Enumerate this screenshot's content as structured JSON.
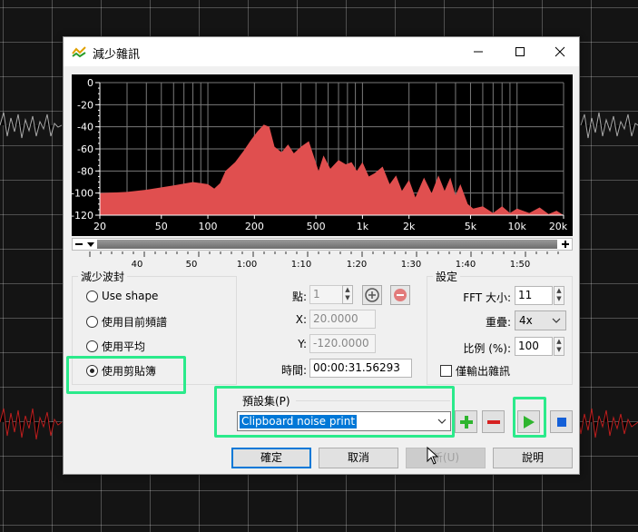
{
  "window": {
    "title": "減少雜訊"
  },
  "plot": {
    "y_ticks": [
      "0",
      "-20",
      "-40",
      "-60",
      "-80",
      "-100",
      "-120"
    ],
    "x_ticks": [
      "20",
      "50",
      "100",
      "200",
      "500",
      "1k",
      "2k",
      "5k",
      "10k",
      "20k"
    ],
    "fill_color": "#e04f4f"
  },
  "timeline": {
    "labels": [
      "40",
      "50",
      "1:00",
      "1:10",
      "1:20",
      "1:30",
      "1:40",
      "1:50"
    ]
  },
  "reduction": {
    "title": "減少波封",
    "options": [
      "Use shape",
      "使用目前頻譜",
      "使用平均",
      "使用剪貼簿"
    ],
    "selected": "使用剪貼簿"
  },
  "point": {
    "point_label": "點:",
    "point_value": "1",
    "x_label": "X:",
    "x_value": "20.0000",
    "y_label": "Y:",
    "y_value": "-120.0000",
    "time_label": "時間:",
    "time_value": "00:00:31.56293"
  },
  "settings": {
    "title": "設定",
    "fft_label": "FFT 大小:",
    "fft_value": "11",
    "overlap_label": "重疊:",
    "overlap_value": "4x",
    "ratio_label": "比例 (%):",
    "ratio_value": "100",
    "noise_only_label": "僅輸出雜訊"
  },
  "presets": {
    "label": "預設集(P)",
    "selected": "Clipboard noise print"
  },
  "buttons": {
    "ok": "確定",
    "cancel": "取消",
    "new": "新(U)",
    "help": "說明"
  },
  "colors": {
    "highlight": "#2bea8b",
    "accent": "#0078d7",
    "add": "#2fb52f",
    "remove": "#d62020",
    "stop": "#1460d8"
  }
}
